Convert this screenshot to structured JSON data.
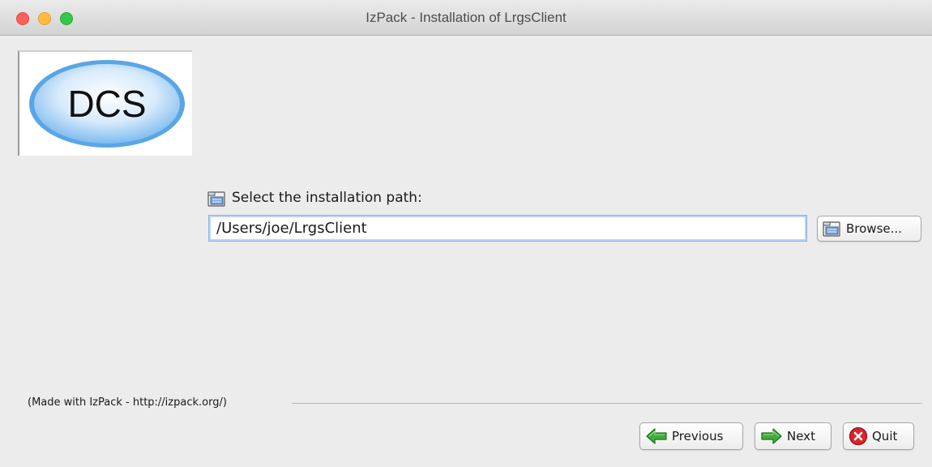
{
  "window": {
    "title": "IzPack - Installation of LrgsClient"
  },
  "logo": {
    "text": "DCS"
  },
  "path_panel": {
    "label": "Select the installation path:",
    "path_value": "/Users/joe/LrgsClient",
    "browse_label": "Browse..."
  },
  "footer": {
    "made_with": "(Made with IzPack - http://izpack.org/)",
    "previous_label": "Previous",
    "next_label": "Next",
    "quit_label": "Quit"
  },
  "icons": {
    "label_icon": "folder-icon",
    "browse_icon": "folder-icon",
    "previous_icon": "arrow-left-icon",
    "next_icon": "arrow-right-icon",
    "quit_icon": "stop-icon"
  },
  "colors": {
    "input_focus_border": "#8db2e3",
    "arrow_green": "#3fae3a",
    "quit_red": "#d8262c",
    "logo_blue": "#6aaee8"
  }
}
